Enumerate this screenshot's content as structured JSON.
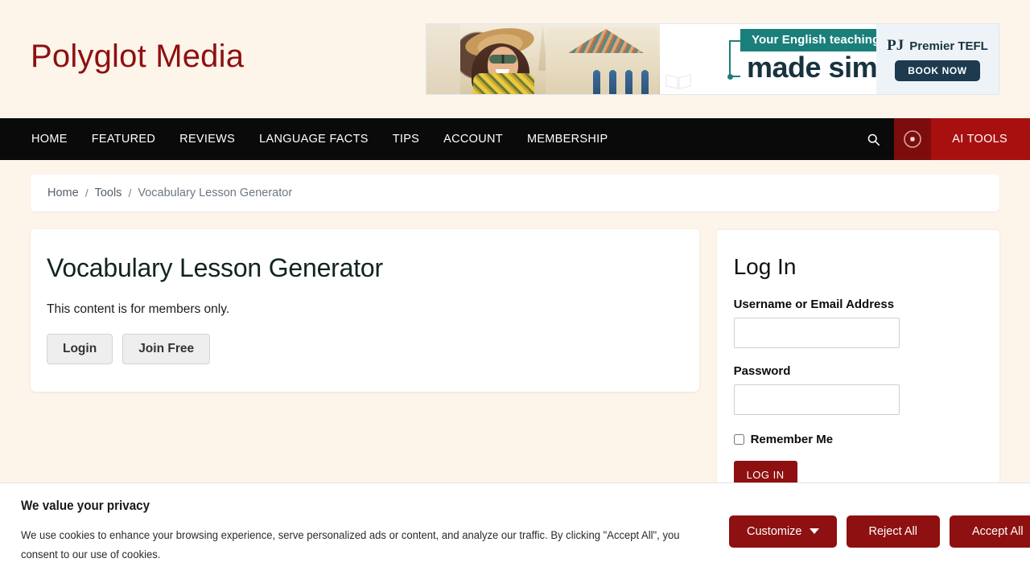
{
  "site": {
    "logo": "Polyglot Media",
    "brand_color": "#8e1010",
    "background_color": "#fdf4ea"
  },
  "ad": {
    "band_text": "Your English teaching adventure",
    "headline": "made simple",
    "brand_mark": "PJ",
    "brand_name": "Premier TEFL",
    "cta": "BOOK NOW",
    "band_color": "#1a7f7a",
    "cta_color": "#1d3a4f"
  },
  "nav": {
    "items": [
      {
        "label": "HOME"
      },
      {
        "label": "FEATURED"
      },
      {
        "label": "REVIEWS"
      },
      {
        "label": "LANGUAGE FACTS"
      },
      {
        "label": "TIPS"
      },
      {
        "label": "ACCOUNT"
      },
      {
        "label": "MEMBERSHIP"
      }
    ],
    "search_icon": "search-icon",
    "ai_icon": "target-circle-icon",
    "ai_label": "AI TOOLS",
    "ai_bg_color": "#a81010"
  },
  "breadcrumb": {
    "home": "Home",
    "sep": "/",
    "tools": "Tools",
    "current": "Vocabulary Lesson Generator"
  },
  "main": {
    "title": "Vocabulary Lesson Generator",
    "notice": "This content is for members only.",
    "login_button": "Login",
    "join_button": "Join Free"
  },
  "login": {
    "title": "Log In",
    "username_label": "Username or Email Address",
    "username_value": "",
    "username_placeholder": "",
    "password_label": "Password",
    "password_value": "",
    "password_placeholder": "",
    "remember_label": "Remember Me",
    "remember_checked": false,
    "submit_label": "LOG IN"
  },
  "cookie": {
    "title": "We value your privacy",
    "body": "We use cookies to enhance your browsing experience, serve personalized ads or content, and analyze our traffic. By clicking \"Accept All\", you consent to our use of cookies.",
    "customize": "Customize",
    "reject": "Reject All",
    "accept": "Accept All",
    "button_color": "#8e1010"
  }
}
